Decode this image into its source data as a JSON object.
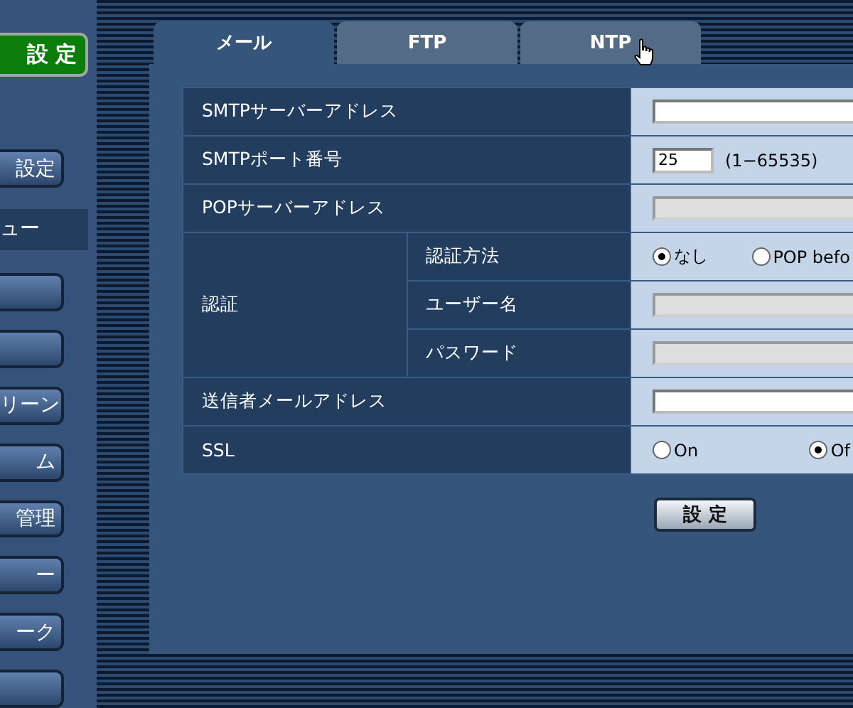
{
  "sidebar": {
    "top_button": {
      "label": "設 定"
    },
    "items": [
      {
        "kind": "button",
        "label": "設定"
      },
      {
        "kind": "band",
        "label": "ュー"
      },
      {
        "kind": "button"
      },
      {
        "kind": "button"
      },
      {
        "kind": "button",
        "label": "リーン"
      },
      {
        "kind": "button",
        "label": "ム"
      },
      {
        "kind": "button",
        "label": "管理"
      },
      {
        "kind": "button",
        "label": "ー"
      },
      {
        "kind": "button",
        "label": "ーク"
      },
      {
        "kind": "button"
      }
    ]
  },
  "tabs": [
    {
      "label": "メール",
      "selected": true
    },
    {
      "label": "FTP",
      "selected": false
    },
    {
      "label": "NTP",
      "selected": false
    }
  ],
  "rows": [
    {
      "label": "SMTPサーバーアドレス",
      "kind": "text",
      "disabled": false
    },
    {
      "label": "SMTPポート番号",
      "kind": "port",
      "value": "25",
      "range": "(1−65535)"
    },
    {
      "label": "POPサーバーアドレス",
      "kind": "text",
      "disabled": true
    },
    {
      "label": "認証",
      "kind": "group",
      "children": [
        {
          "label": "認証方法",
          "kind": "radio",
          "options": [
            {
              "label": "なし",
              "selected": true
            },
            {
              "label": "POP befo",
              "selected": false
            }
          ]
        },
        {
          "label": "ユーザー名",
          "kind": "text",
          "disabled": true
        },
        {
          "label": "パスワード",
          "kind": "text",
          "disabled": true
        }
      ]
    },
    {
      "label": "送信者メールアドレス",
      "kind": "text",
      "disabled": false
    },
    {
      "label": "SSL",
      "kind": "radio",
      "options": [
        {
          "label": "On",
          "selected": false
        },
        {
          "label": "Of",
          "selected": true
        }
      ]
    }
  ],
  "submit": {
    "label": "設 定"
  }
}
